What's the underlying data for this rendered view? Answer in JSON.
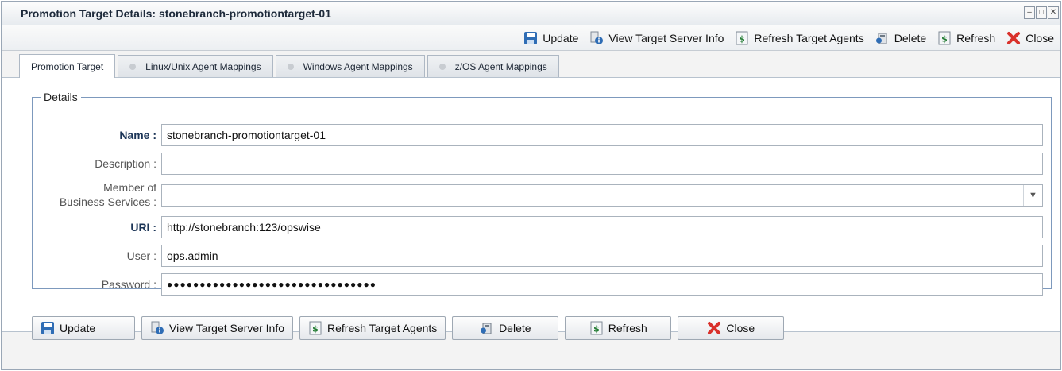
{
  "window": {
    "title": "Promotion Target Details: stonebranch-promotiontarget-01",
    "controls": [
      "minimize-icon",
      "maximize-icon",
      "close-icon"
    ]
  },
  "toolbar": {
    "update": "Update",
    "view_target_server_info": "View Target Server Info",
    "refresh_target_agents": "Refresh Target Agents",
    "delete": "Delete",
    "refresh": "Refresh",
    "close": "Close"
  },
  "tabs": [
    {
      "label": "Promotion Target",
      "active": true
    },
    {
      "label": "Linux/Unix Agent Mappings",
      "active": false
    },
    {
      "label": "Windows Agent Mappings",
      "active": false
    },
    {
      "label": "z/OS Agent Mappings",
      "active": false
    }
  ],
  "details": {
    "legend": "Details",
    "name_label": "Name :",
    "name_value": "stonebranch-promotiontarget-01",
    "description_label": "Description :",
    "description_value": "",
    "member_label_line1": "Member of",
    "member_label_line2": "Business Services :",
    "member_value": "",
    "uri_label": "URI :",
    "uri_value": "http://stonebranch:123/opswise",
    "user_label": "User :",
    "user_value": "ops.admin",
    "password_label": "Password :",
    "password_value": "●●●●●●●●●●●●●●●●●●●●●●●●●●●●●●●●"
  },
  "buttons": {
    "update": "Update",
    "view_target_server_info": "View Target Server Info",
    "refresh_target_agents": "Refresh Target Agents",
    "delete": "Delete",
    "refresh": "Refresh",
    "close": "Close"
  },
  "colors": {
    "accent": "#1c3557",
    "fieldset_border": "#7d99bd",
    "close_icon": "#d9312b",
    "update_icon": "#2f6db5"
  }
}
